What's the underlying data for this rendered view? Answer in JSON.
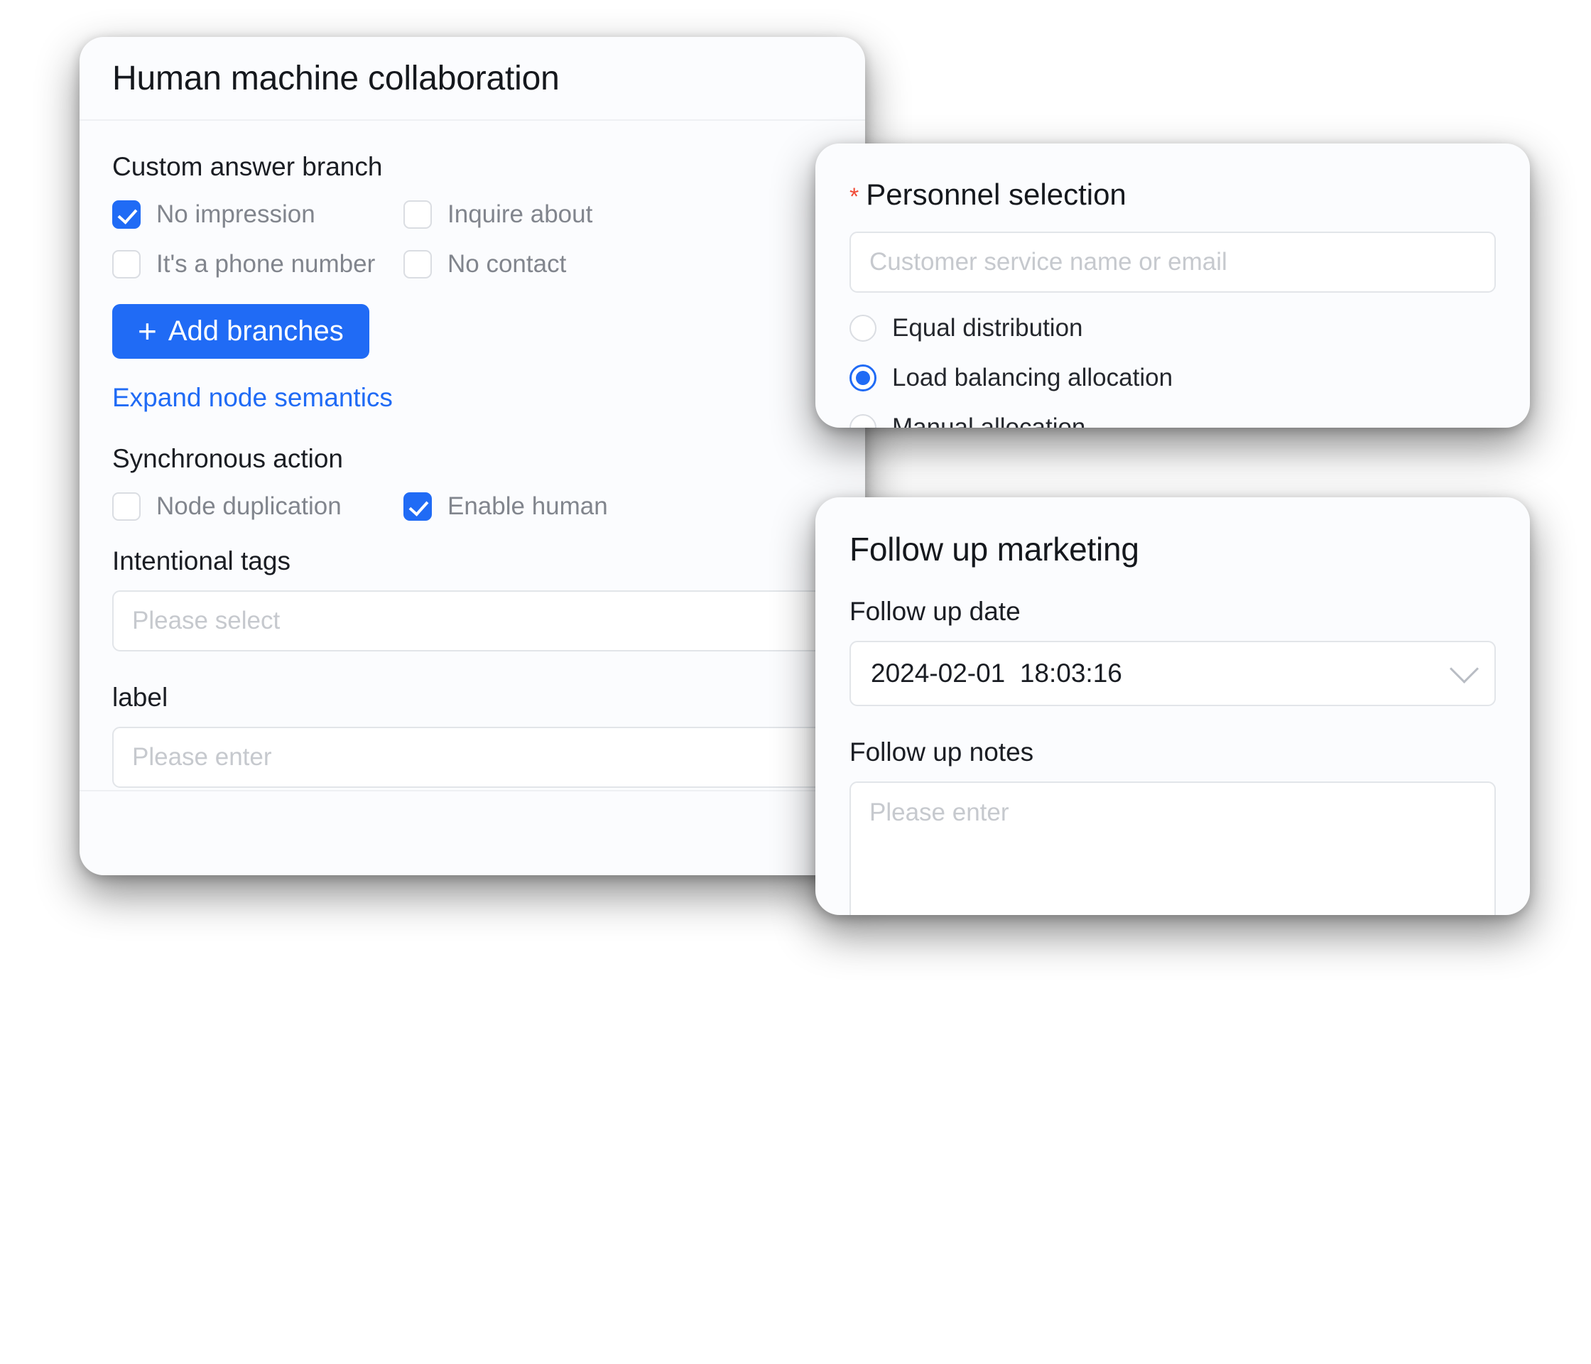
{
  "main_card": {
    "title": "Human machine collaboration",
    "custom_answer_branch": {
      "section_label": "Custom answer branch",
      "options": [
        {
          "label": "No impression",
          "checked": true
        },
        {
          "label": "Inquire about",
          "checked": false
        },
        {
          "label": "It's a phone number",
          "checked": false
        },
        {
          "label": "No contact",
          "checked": false
        }
      ],
      "add_button": "Add branches",
      "add_button_icon": "plus-icon",
      "expand_link": "Expand node semantics"
    },
    "synchronous_action": {
      "section_label": "Synchronous action",
      "options": [
        {
          "label": "Node duplication",
          "checked": false
        },
        {
          "label": "Enable human",
          "checked": true
        }
      ]
    },
    "intentional_tags": {
      "label": "Intentional tags",
      "placeholder": "Please select",
      "value": ""
    },
    "label_field": {
      "label": "label",
      "placeholder": "Please enter",
      "value": ""
    }
  },
  "personnel_card": {
    "required_marker": "*",
    "title": "Personnel selection",
    "search": {
      "placeholder": "Customer service name or email",
      "value": ""
    },
    "allocation_options": [
      {
        "label": "Equal distribution",
        "selected": false
      },
      {
        "label": "Load balancing allocation",
        "selected": true
      },
      {
        "label": "Manual allocation",
        "selected": false
      }
    ]
  },
  "followup_card": {
    "title": "Follow up marketing",
    "date_field": {
      "label": "Follow up date",
      "value": "2024-02-01  18:03:16",
      "icon": "chevron-down-icon"
    },
    "notes_field": {
      "label": "Follow up notes",
      "placeholder": "Please enter",
      "value": ""
    }
  },
  "colors": {
    "accent": "#206bf5",
    "required": "#f04a36",
    "card_bg": "#fbfcfe",
    "muted_text": "#81858d",
    "placeholder": "#c6c9ce"
  }
}
